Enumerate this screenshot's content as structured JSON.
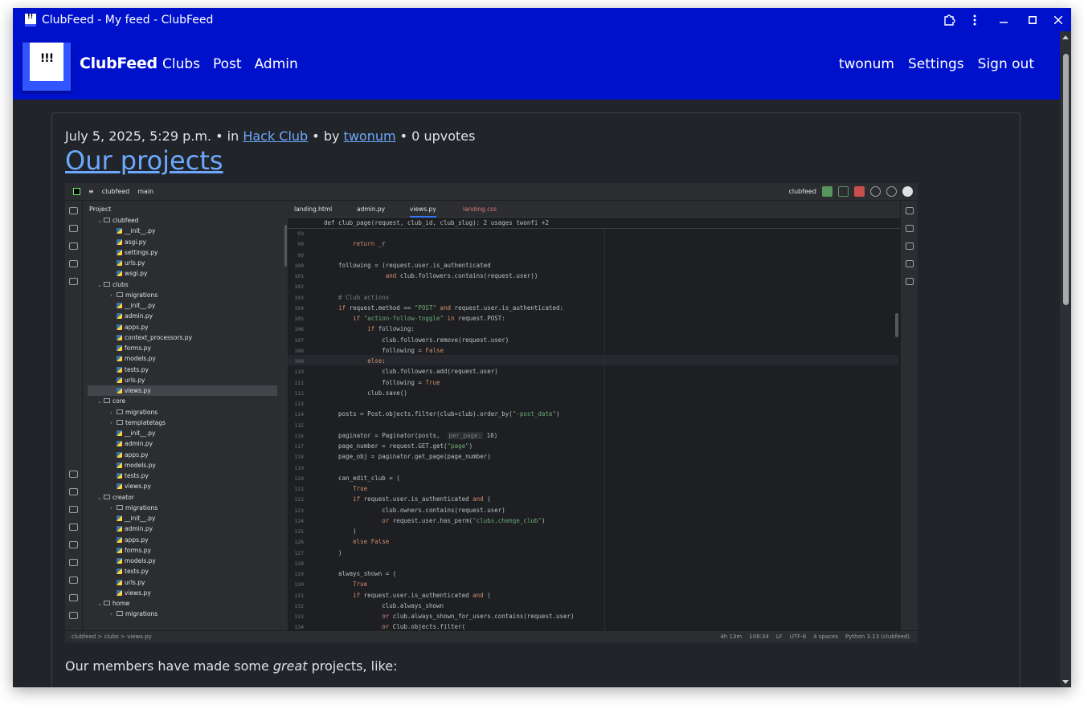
{
  "window": {
    "title": "ClubFeed - My feed - ClubFeed",
    "icons": [
      "extension-icon",
      "menu-kebab-icon",
      "minimize-icon",
      "maximize-icon",
      "close-icon"
    ]
  },
  "navbar": {
    "logo_text": "!!!",
    "brand": "ClubFeed",
    "links": [
      "Clubs",
      "Post",
      "Admin"
    ],
    "user": "twonum",
    "settings": "Settings",
    "signout": "Sign out"
  },
  "post": {
    "date": "July 5, 2025, 5:29 p.m.",
    "sep1": " • in ",
    "club": "Hack Club",
    "sep2": " • by ",
    "author": "twonum",
    "sep3": " • ",
    "upvotes": "0 upvotes",
    "title": "Our projects",
    "body_pre": "Our members have made some ",
    "body_em": "great",
    "body_post": " projects, like:"
  },
  "ide": {
    "project_name": "clubfeed",
    "branch": "main",
    "run_config": "clubfeed",
    "panel_title": "Project",
    "tabs": [
      "landing.html",
      "admin.py",
      "views.py",
      "landing.css"
    ],
    "active_tab": "views.py",
    "breadcrumb": "def club_page(request, club_id, club_slug):  2 usages  twonfi +2",
    "status_path": "clubfeed  >  clubs  >  views.py",
    "status_items": [
      "4h 13m",
      "108:34",
      "LF",
      "UTF-8",
      "4 spaces",
      "Python 3.13 (clubfeed)"
    ],
    "tree": [
      {
        "depth": 1,
        "kind": "dir",
        "name": "clubfeed",
        "open": true
      },
      {
        "depth": 2,
        "kind": "py",
        "name": "__init__.py"
      },
      {
        "depth": 2,
        "kind": "py",
        "name": "asgi.py"
      },
      {
        "depth": 2,
        "kind": "py",
        "name": "settings.py"
      },
      {
        "depth": 2,
        "kind": "py",
        "name": "urls.py"
      },
      {
        "depth": 2,
        "kind": "py",
        "name": "wsgi.py"
      },
      {
        "depth": 1,
        "kind": "dir",
        "name": "clubs",
        "open": true
      },
      {
        "depth": 2,
        "kind": "dir",
        "name": "migrations",
        "open": false
      },
      {
        "depth": 2,
        "kind": "py",
        "name": "__init__.py"
      },
      {
        "depth": 2,
        "kind": "py",
        "name": "admin.py"
      },
      {
        "depth": 2,
        "kind": "py",
        "name": "apps.py"
      },
      {
        "depth": 2,
        "kind": "py",
        "name": "context_processors.py"
      },
      {
        "depth": 2,
        "kind": "py",
        "name": "forms.py"
      },
      {
        "depth": 2,
        "kind": "py",
        "name": "models.py"
      },
      {
        "depth": 2,
        "kind": "py",
        "name": "tests.py"
      },
      {
        "depth": 2,
        "kind": "py",
        "name": "urls.py"
      },
      {
        "depth": 2,
        "kind": "py",
        "name": "views.py",
        "selected": true
      },
      {
        "depth": 1,
        "kind": "dir",
        "name": "core",
        "open": true
      },
      {
        "depth": 2,
        "kind": "dir",
        "name": "migrations",
        "open": false
      },
      {
        "depth": 2,
        "kind": "dir",
        "name": "templatetags",
        "open": false
      },
      {
        "depth": 2,
        "kind": "py",
        "name": "__init__.py"
      },
      {
        "depth": 2,
        "kind": "py",
        "name": "admin.py"
      },
      {
        "depth": 2,
        "kind": "py",
        "name": "apps.py"
      },
      {
        "depth": 2,
        "kind": "py",
        "name": "models.py"
      },
      {
        "depth": 2,
        "kind": "py",
        "name": "tests.py"
      },
      {
        "depth": 2,
        "kind": "py",
        "name": "views.py"
      },
      {
        "depth": 1,
        "kind": "dir",
        "name": "creator",
        "open": true
      },
      {
        "depth": 2,
        "kind": "dir",
        "name": "migrations",
        "open": false
      },
      {
        "depth": 2,
        "kind": "py",
        "name": "__init__.py"
      },
      {
        "depth": 2,
        "kind": "py",
        "name": "admin.py"
      },
      {
        "depth": 2,
        "kind": "py",
        "name": "apps.py"
      },
      {
        "depth": 2,
        "kind": "py",
        "name": "forms.py"
      },
      {
        "depth": 2,
        "kind": "py",
        "name": "models.py"
      },
      {
        "depth": 2,
        "kind": "py",
        "name": "tests.py"
      },
      {
        "depth": 2,
        "kind": "py",
        "name": "urls.py"
      },
      {
        "depth": 2,
        "kind": "py",
        "name": "views.py"
      },
      {
        "depth": 1,
        "kind": "dir",
        "name": "home",
        "open": true
      },
      {
        "depth": 2,
        "kind": "dir",
        "name": "migrations",
        "open": false
      }
    ],
    "code": [
      {
        "n": "93",
        "t": ""
      },
      {
        "n": "99",
        "t": "        return _r"
      },
      {
        "n": "99",
        "t": ""
      },
      {
        "n": "100",
        "t": "    following = (request.user.is_authenticated"
      },
      {
        "n": "101",
        "t": "                 and club.followers.contains(request.user))"
      },
      {
        "n": "102",
        "t": ""
      },
      {
        "n": "103",
        "t": "    # Club actions"
      },
      {
        "n": "104",
        "t": "    if request.method == \"POST\" and request.user.is_authenticated:"
      },
      {
        "n": "105",
        "t": "        if \"action-follow-toggle\" in request.POST:"
      },
      {
        "n": "106",
        "t": "            if following:"
      },
      {
        "n": "107",
        "t": "                club.followers.remove(request.user)"
      },
      {
        "n": "108",
        "t": "                following = False"
      },
      {
        "n": "109",
        "t": "            else:"
      },
      {
        "n": "110",
        "t": "                club.followers.add(request.user)"
      },
      {
        "n": "111",
        "t": "                following = True"
      },
      {
        "n": "112",
        "t": "            club.save()"
      },
      {
        "n": "113",
        "t": ""
      },
      {
        "n": "114",
        "t": "    posts = Post.objects.filter(club=club).order_by(\"-post_date\")"
      },
      {
        "n": "115",
        "t": ""
      },
      {
        "n": "116",
        "t": "    paginator = Paginator(posts,  per_page: 10)"
      },
      {
        "n": "117",
        "t": "    page_number = request.GET.get(\"page\")"
      },
      {
        "n": "118",
        "t": "    page_obj = paginator.get_page(page_number)"
      },
      {
        "n": "119",
        "t": ""
      },
      {
        "n": "120",
        "t": "    can_edit_club = ("
      },
      {
        "n": "121",
        "t": "        True"
      },
      {
        "n": "122",
        "t": "        if request.user.is_authenticated and ("
      },
      {
        "n": "123",
        "t": "                club.owners.contains(request.user)"
      },
      {
        "n": "124",
        "t": "                or request.user.has_perm(\"clubs.change_club\")"
      },
      {
        "n": "125",
        "t": "        )"
      },
      {
        "n": "126",
        "t": "        else False"
      },
      {
        "n": "127",
        "t": "    )"
      },
      {
        "n": "128",
        "t": ""
      },
      {
        "n": "129",
        "t": "    always_shown = ("
      },
      {
        "n": "130",
        "t": "        True"
      },
      {
        "n": "131",
        "t": "        if request.user.is_authenticated and ("
      },
      {
        "n": "132",
        "t": "                club.always_shown"
      },
      {
        "n": "133",
        "t": "                or club.always_shown_for_users.contains(request.user)"
      },
      {
        "n": "134",
        "t": "                or Club.objects.filter("
      }
    ]
  }
}
